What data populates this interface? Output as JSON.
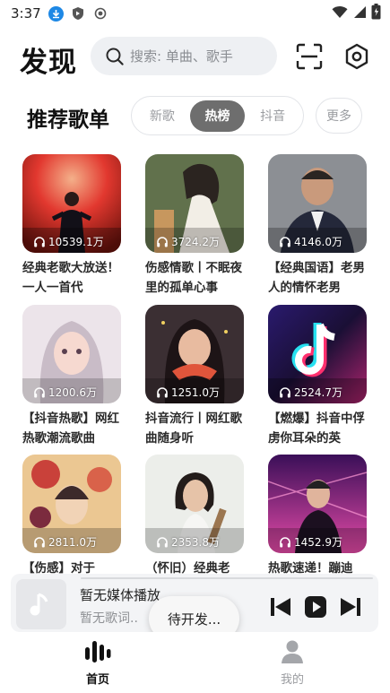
{
  "status_bar": {
    "time": "3:37"
  },
  "header": {
    "title": "发现",
    "search_placeholder": "搜索: 单曲、歌手"
  },
  "section": {
    "title": "推荐歌单",
    "tabs": [
      {
        "label": "新歌",
        "active": false
      },
      {
        "label": "热榜",
        "active": true
      },
      {
        "label": "抖音",
        "active": false
      }
    ],
    "more_label": "更多"
  },
  "playlists": [
    {
      "plays": "10539.1万",
      "title": "经典老歌大放送！一人一首代",
      "palette": [
        "#e8453c",
        "#7a1c12"
      ]
    },
    {
      "plays": "3724.2万",
      "title": "伤感情歌丨不眠夜里的孤单心事",
      "palette": [
        "#6d7c55",
        "#c9a37c"
      ]
    },
    {
      "plays": "4146.0万",
      "title": "【经典国语】老男人的情怀老男",
      "palette": [
        "#8a8d93",
        "#2b2f3a"
      ]
    },
    {
      "plays": "1200.6万",
      "title": "【抖音热歌】网红热歌潮流歌曲",
      "palette": [
        "#e9e2e8",
        "#b7a6b8"
      ]
    },
    {
      "plays": "1251.0万",
      "title": "抖音流行丨网红歌曲随身听",
      "palette": [
        "#3a2e33",
        "#d9654a"
      ]
    },
    {
      "plays": "2524.7万",
      "title": "【燃爆】抖音中俘虏你耳朵的英",
      "palette": [
        "#1b0f3a",
        "#e0318c"
      ]
    },
    {
      "plays": "2811.0万",
      "title": "【伤感】对于",
      "palette": [
        "#e9c28f",
        "#d35b3c"
      ]
    },
    {
      "plays": "2353.8万",
      "title": "（怀旧）经典老",
      "palette": [
        "#e9ebe8",
        "#b99f7a"
      ]
    },
    {
      "plays": "1452.9万",
      "title": "热歌速递！蹦迪",
      "palette": [
        "#3a1150",
        "#e64aa8"
      ]
    }
  ],
  "player": {
    "title": "暂无媒体播放",
    "subtitle": "暂无歌词..",
    "progress": 0
  },
  "toast": "待开发...",
  "bottom_nav": [
    {
      "label": "首页",
      "active": true,
      "icon": "bars-icon"
    },
    {
      "label": "我的",
      "active": false,
      "icon": "user-icon"
    }
  ]
}
